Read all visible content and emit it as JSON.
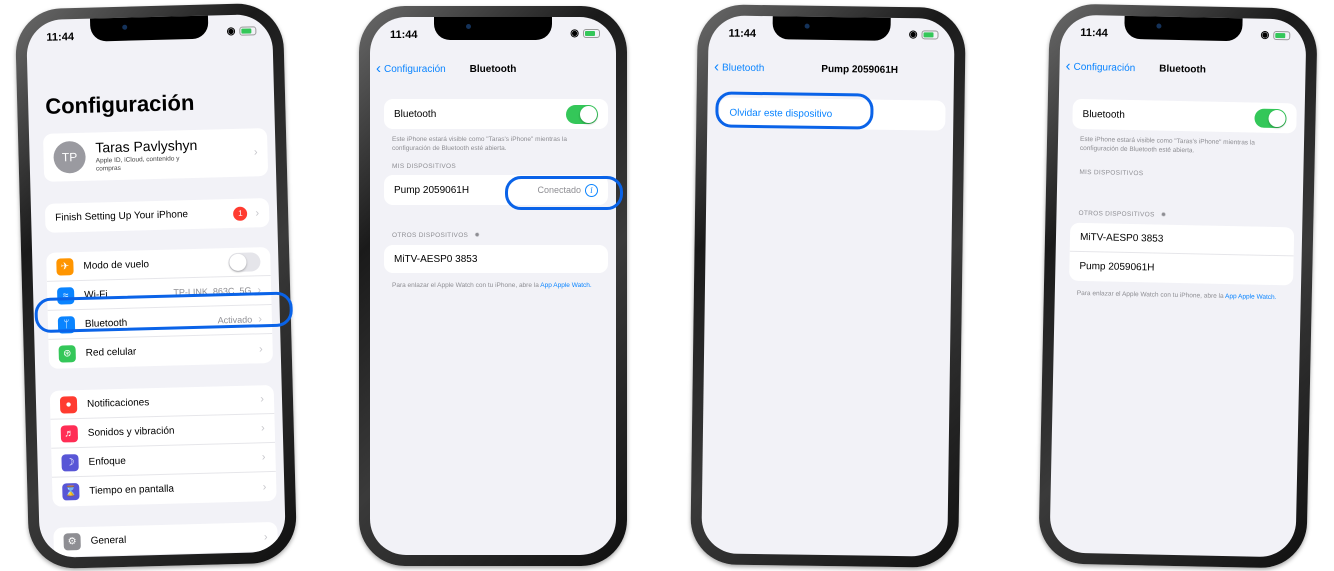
{
  "status": {
    "time": "11:44"
  },
  "screen1": {
    "title": "Configuración",
    "profile": {
      "initials": "TP",
      "name": "Taras Pavlyshyn",
      "subtitle": "Apple ID, iCloud, contenido y compras"
    },
    "finish_setup": {
      "label": "Finish Setting Up Your iPhone",
      "badge": "1"
    },
    "network_rows": [
      {
        "label": "Modo de vuelo",
        "icon": "airplane-icon",
        "color": "#ff9500",
        "toggle": false
      },
      {
        "label": "Wi-Fi",
        "icon": "wifi-icon",
        "color": "#0a84ff",
        "value": "TP-LINK_863C_5G"
      },
      {
        "label": "Bluetooth",
        "icon": "bluetooth-icon",
        "color": "#0a84ff",
        "value": "Activado"
      },
      {
        "label": "Red celular",
        "icon": "antenna-icon",
        "color": "#34c759"
      }
    ],
    "notif_rows": [
      {
        "label": "Notificaciones",
        "icon": "bell-icon",
        "color": "#ff3b30"
      },
      {
        "label": "Sonidos y vibración",
        "icon": "speaker-icon",
        "color": "#ff2d55"
      },
      {
        "label": "Enfoque",
        "icon": "moon-icon",
        "color": "#5856d6"
      },
      {
        "label": "Tiempo en pantalla",
        "icon": "hourglass-icon",
        "color": "#5856d6"
      }
    ],
    "general": {
      "label": "General",
      "icon": "gear-icon",
      "color": "#8e8e93"
    }
  },
  "screen2": {
    "back_label": "Configuración",
    "nav_title": "Bluetooth",
    "toggle_label": "Bluetooth",
    "toggle_on": true,
    "visibility_note": "Este iPhone estará visible como \"Taras's iPhone\" mientras la configuración de Bluetooth esté abierta.",
    "my_devices_header": "MIS DISPOSITIVOS",
    "my_devices": [
      {
        "name": "Pump 2059061H",
        "status": "Conectado"
      }
    ],
    "other_devices_header": "OTROS DISPOSITIVOS",
    "other_devices": [
      "MiTV-AESP0 3853"
    ],
    "watch_note": "Para enlazar el Apple Watch con tu iPhone, abre la",
    "watch_link": "App Apple Watch."
  },
  "screen3": {
    "back_label": "Bluetooth",
    "nav_title": "Pump 2059061H",
    "forget_label": "Olvidar este dispositivo"
  },
  "screen4": {
    "back_label": "Configuración",
    "nav_title": "Bluetooth",
    "toggle_label": "Bluetooth",
    "toggle_on": true,
    "visibility_note": "Este iPhone estará visible como \"Taras's iPhone\" mientras la configuración de Bluetooth esté abierta.",
    "my_devices_header": "MIS DISPOSITIVOS",
    "other_devices_header": "OTROS DISPOSITIVOS",
    "other_devices": [
      "MiTV-AESP0 3853",
      "Pump 2059061H"
    ],
    "watch_note": "Para enlazar el Apple Watch con tu iPhone, abre la",
    "watch_link": "App Apple Watch."
  },
  "colors": {
    "accent": "#0a84ff",
    "toggle_on": "#34c759",
    "highlight": "#0a63e8"
  }
}
